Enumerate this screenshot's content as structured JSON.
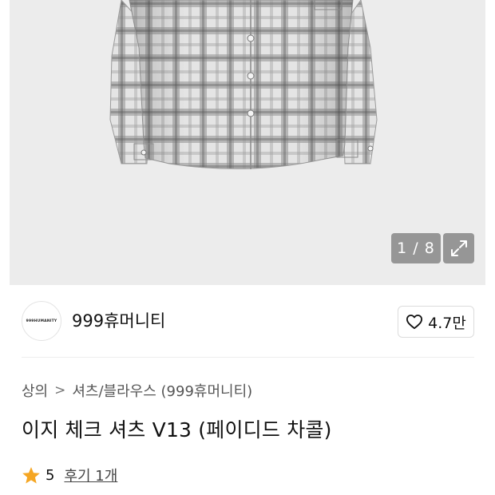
{
  "gallery": {
    "counter": "1 / 8",
    "image_alt": "check shirt"
  },
  "brand": {
    "logo_text": "999HUMANITY",
    "name": "999휴머니티"
  },
  "like": {
    "count": "4.7만"
  },
  "breadcrumb": {
    "category": "상의",
    "separator": ">",
    "subcategory": "셔츠/블라우스 (999휴머니티)"
  },
  "product": {
    "title": "이지 체크 셔츠 V13 (페이디드 차콜)"
  },
  "rating": {
    "score": "5",
    "review_link": "후기 1개"
  },
  "colors": {
    "star": "#f5a623",
    "gallery_bg": "#ececec",
    "shirt_base": "#d9d9d9",
    "check_line": "#6e6e6e"
  }
}
